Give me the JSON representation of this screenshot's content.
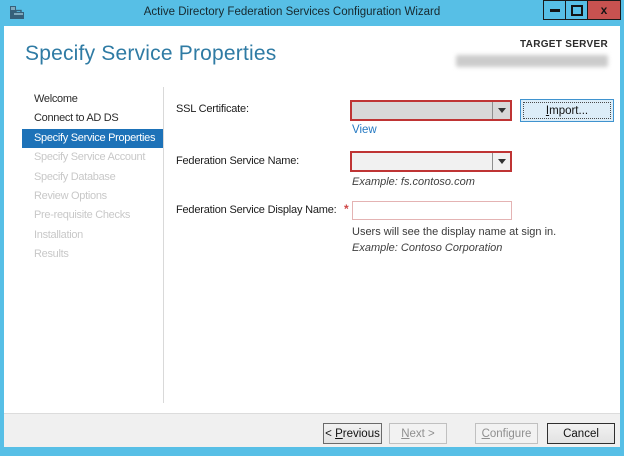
{
  "window": {
    "title": "Active Directory Federation Services Configuration Wizard",
    "icons": {
      "app": "adfs-wizard-icon",
      "minimize": "minimize-dash",
      "maximize": "maximize-square",
      "close": "x"
    }
  },
  "header": {
    "page_title": "Specify Service Properties",
    "target_server_label": "TARGET SERVER",
    "target_server_value": ""
  },
  "sidebar": {
    "items": [
      {
        "label": "Welcome",
        "state": "enabled"
      },
      {
        "label": "Connect to AD DS",
        "state": "enabled"
      },
      {
        "label": "Specify Service Properties",
        "state": "selected"
      },
      {
        "label": "Specify Service Account",
        "state": "disabled"
      },
      {
        "label": "Specify Database",
        "state": "disabled"
      },
      {
        "label": "Review Options",
        "state": "disabled"
      },
      {
        "label": "Pre-requisite Checks",
        "state": "disabled"
      },
      {
        "label": "Installation",
        "state": "disabled"
      },
      {
        "label": "Results",
        "state": "disabled"
      }
    ]
  },
  "form": {
    "ssl_certificate": {
      "label": "SSL Certificate:",
      "value": "",
      "import_button": {
        "mnemonic": "I",
        "rest": "mport..."
      },
      "view_link": "View"
    },
    "federation_service_name": {
      "label": "Federation Service Name:",
      "value": "",
      "example": "Example: fs.contoso.com"
    },
    "federation_service_display_name": {
      "label": "Federation Service Display Name:",
      "required_marker": "*",
      "value": "",
      "help": "Users will see the display name at sign in.",
      "example": "Example: Contoso Corporation"
    }
  },
  "footer": {
    "previous": {
      "prefix": "< ",
      "mnemonic": "P",
      "rest": "revious"
    },
    "next": {
      "mnemonic": "N",
      "rest": "ext >"
    },
    "configure": {
      "mnemonic": "C",
      "rest": "onfigure"
    },
    "cancel": "Cancel"
  },
  "colors": {
    "titlebar_blue": "#57bfe6",
    "selected_nav_blue": "#1d72b8",
    "heading_blue": "#2f7ba4",
    "link_blue": "#2579c2",
    "error_border_red": "#bf3434",
    "close_button_red": "#c85250",
    "footer_gray": "#f0f0f0"
  }
}
